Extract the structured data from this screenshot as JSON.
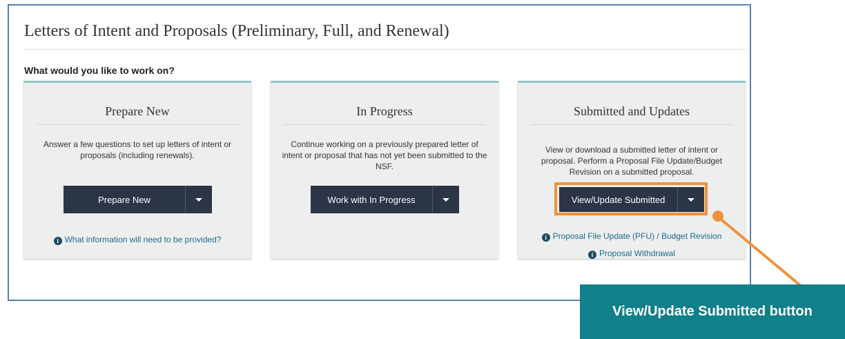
{
  "page": {
    "title": "Letters of Intent and Proposals (Preliminary, Full, and Renewal)",
    "subhead": "What would you like to work on?"
  },
  "cards": [
    {
      "title": "Prepare New",
      "description": "Answer a few questions to set up letters of intent or proposals (including renewals).",
      "button_label": "Prepare New",
      "links": [
        "What information will need to be provided?"
      ]
    },
    {
      "title": "In Progress",
      "description": "Continue working on a previously prepared letter of intent or proposal that has not yet been submitted to the NSF.",
      "button_label": "Work with In Progress",
      "links": []
    },
    {
      "title": "Submitted and Updates",
      "description": "View or download a submitted letter of intent or proposal. Perform a Proposal File Update/Budget Revision on a submitted proposal.",
      "button_label": "View/Update Submitted",
      "links": [
        "Proposal File Update (PFU) / Budget Revision",
        "Proposal Withdrawal"
      ]
    }
  ],
  "callout": {
    "label": "View/Update Submitted button"
  },
  "icons": {
    "info": "info-circle-icon",
    "dropdown": "caret-down-icon"
  },
  "colors": {
    "panel_border": "#5a7fb4",
    "card_top_accent": "#8fcbc5",
    "button_bg": "#2b3546",
    "link": "#1e6a8e",
    "highlight": "#f0923a",
    "callout_bg": "#12808a"
  }
}
